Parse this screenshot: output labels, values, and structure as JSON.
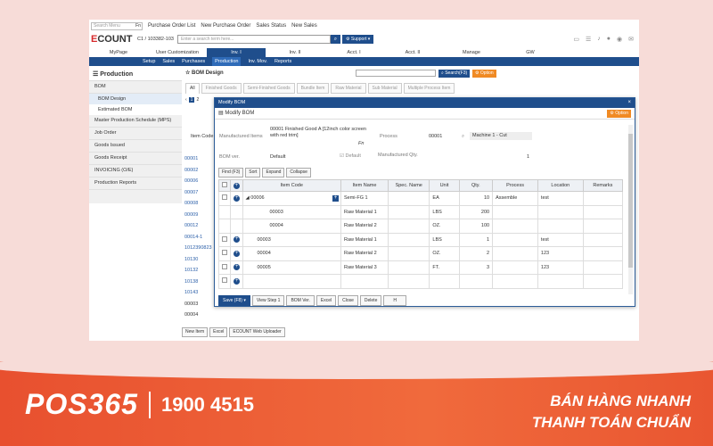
{
  "topnav": {
    "search_placeholder": "Search Menu",
    "search_fn": "Fn",
    "links": [
      "Purchase Order List",
      "New Purchase Order",
      "Sales Status",
      "New Sales"
    ]
  },
  "header": {
    "logo_accent": "E",
    "logo_rest": "COUNT",
    "company": "C1 / 103382-103",
    "search_placeholder": "Enter a search term here...",
    "support_label": "Support"
  },
  "menubar": [
    "MyPage",
    "User Customization",
    "Inv. I",
    "Inv. II",
    "Acct. I",
    "Acct. II",
    "Manage",
    "GW"
  ],
  "submenu": [
    "Setup",
    "Sales",
    "Purchases",
    "Production",
    "Inv. Mov.",
    "Reports"
  ],
  "sidebar": {
    "title": "Production",
    "items": [
      {
        "label": "BOM",
        "subs": [
          "BOM Design",
          "Estimated BOM"
        ]
      },
      {
        "label": "Master Production Schedule (MPS)"
      },
      {
        "label": "Job Order"
      },
      {
        "label": "Goods Issued"
      },
      {
        "label": "Goods Receipt"
      },
      {
        "label": "INVOICING (O/E)"
      },
      {
        "label": "Production Reports"
      }
    ]
  },
  "bom": {
    "title": "BOM Design",
    "search_label": "Search(F3)",
    "option_label": "Option",
    "tabs": [
      "All",
      "Finished Goods",
      "Semi-Finished Goods",
      "Bundle Item",
      "Raw Material",
      "Sub Material",
      "Multiple Process Item"
    ],
    "pages": [
      "1",
      "2"
    ],
    "item_code_header": "Item Code",
    "left_codes": [
      "00001",
      "00002",
      "00006",
      "00007",
      "00008",
      "00009",
      "00012",
      "00014-1",
      "1012390823",
      "10130",
      "10132",
      "10138",
      "10143",
      "00003",
      "00004"
    ],
    "bottom_buttons": [
      "New Item",
      "Excel",
      "ECOUNT Web Uploader"
    ]
  },
  "modal": {
    "title": "Modify BOM",
    "subtitle": "Modify BOM",
    "option_label": "Option",
    "close": "×",
    "manufactured_items_label": "Manufactured Items",
    "manufactured_items_value": "00001 Finished Good A [12inch color screen with red trim]",
    "fn": "Fn",
    "process_label": "Process",
    "process_code": "00001",
    "process_name": "Machine 1 - Cut",
    "bom_ver_label": "BOM ver.",
    "bom_ver_value": "Default",
    "default_label": "Default",
    "manufactured_qty_label": "Manufactured Qty.",
    "manufactured_qty_value": "1",
    "toolbar": [
      "Find (F3)",
      "Sort",
      "Expand",
      "Collapse"
    ],
    "columns": [
      "Item Code",
      "Item Name",
      "Spec. Name",
      "Unit",
      "Qty.",
      "Process",
      "Location",
      "Remarks"
    ],
    "rows": [
      {
        "code": "00006",
        "name": "Semi-FG 1",
        "spec": "",
        "unit": "EA",
        "qty": "10",
        "process": "Assemble",
        "location": "test",
        "remarks": "",
        "level": 0,
        "expand": true
      },
      {
        "code": "00003",
        "name": "Raw Material 1",
        "spec": "",
        "unit": "LBS",
        "qty": "200",
        "process": "",
        "location": "",
        "remarks": "",
        "level": 1
      },
      {
        "code": "00004",
        "name": "Raw Material 2",
        "spec": "",
        "unit": "OZ.",
        "qty": "100",
        "process": "",
        "location": "",
        "remarks": "",
        "level": 1
      },
      {
        "code": "00003",
        "name": "Raw Material 1",
        "spec": "",
        "unit": "LBS",
        "qty": "1",
        "process": "",
        "location": "test",
        "remarks": "",
        "level": 0
      },
      {
        "code": "00004",
        "name": "Raw Material 2",
        "spec": "",
        "unit": "OZ.",
        "qty": "2",
        "process": "",
        "location": "123",
        "remarks": "",
        "level": 0
      },
      {
        "code": "00005",
        "name": "Raw Material 3",
        "spec": "",
        "unit": "FT.",
        "qty": "3",
        "process": "",
        "location": "123",
        "remarks": "",
        "level": 0
      },
      {
        "code": "",
        "name": "",
        "spec": "",
        "unit": "",
        "qty": "",
        "process": "",
        "location": "",
        "remarks": "",
        "level": 0
      }
    ],
    "footer": [
      "Save (F8)",
      "View Step 1",
      "BOM Ver.",
      "Excel",
      "Close",
      "Delete",
      "H"
    ]
  },
  "brand": {
    "logo": "POS365",
    "phone": "1900 4515",
    "slogan_1": "BÁN HÀNG NHANH",
    "slogan_2": "THANH TOÁN CHUẨN"
  }
}
